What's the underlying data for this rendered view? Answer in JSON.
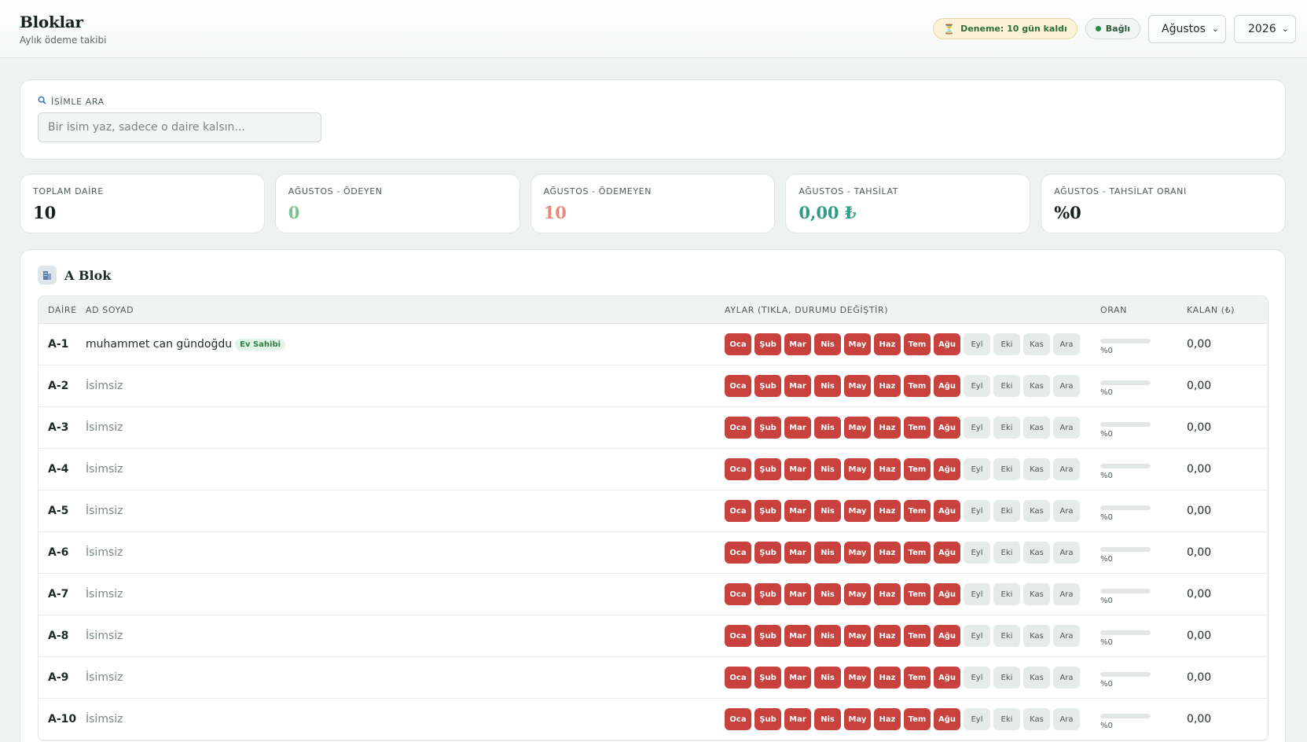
{
  "header": {
    "title": "Bloklar",
    "subtitle": "Aylık ödeme takibi",
    "trial_badge": "Deneme: 10 gün kaldı",
    "connection_badge": "Bağlı",
    "month_select": "Ağustos",
    "year_select": "2026"
  },
  "search": {
    "label": "İSİMLE ARA",
    "placeholder": "Bir isim yaz, sadece o daire kalsın...",
    "value": ""
  },
  "stats": [
    {
      "label": "TOPLAM DAİRE",
      "value": "10",
      "color": "#17211f"
    },
    {
      "label": "AĞUSTOS - ÖDEYEN",
      "value": "0",
      "color": "#7cc48f"
    },
    {
      "label": "AĞUSTOS - ÖDEMEYEN",
      "value": "10",
      "color": "#e8897c"
    },
    {
      "label": "AĞUSTOS - TAHSİLAT",
      "value": "0,00 ₺",
      "color": "#2e9c86"
    },
    {
      "label": "AĞUSTOS - TAHSİLAT ORANI",
      "value": "%0",
      "color": "#17211f"
    }
  ],
  "block": {
    "title": "A Blok",
    "columns": {
      "daire": "DAİRE",
      "ad": "AD SOYAD",
      "aylar": "AYLAR (TIKLA, DURUMU DEĞİŞTİR)",
      "oran": "ORAN",
      "kalan": "KALAN (₺)"
    },
    "months": [
      "Oca",
      "Şub",
      "Mar",
      "Nis",
      "May",
      "Haz",
      "Tem",
      "Ağu",
      "Eyl",
      "Eki",
      "Kas",
      "Ara"
    ],
    "unpaid_count": 8,
    "owner_tag": "Ev Sahibi",
    "rows": [
      {
        "daire": "A-1",
        "name": "muhammet can gündoğdu",
        "owner": true,
        "oran": "%0",
        "ratio": 0,
        "kalan": "0,00"
      },
      {
        "daire": "A-2",
        "name": "İsimsiz",
        "owner": false,
        "oran": "%0",
        "ratio": 0,
        "kalan": "0,00"
      },
      {
        "daire": "A-3",
        "name": "İsimsiz",
        "owner": false,
        "oran": "%0",
        "ratio": 0,
        "kalan": "0,00"
      },
      {
        "daire": "A-4",
        "name": "İsimsiz",
        "owner": false,
        "oran": "%0",
        "ratio": 0,
        "kalan": "0,00"
      },
      {
        "daire": "A-5",
        "name": "İsimsiz",
        "owner": false,
        "oran": "%0",
        "ratio": 0,
        "kalan": "0,00"
      },
      {
        "daire": "A-6",
        "name": "İsimsiz",
        "owner": false,
        "oran": "%0",
        "ratio": 0,
        "kalan": "0,00"
      },
      {
        "daire": "A-7",
        "name": "İsimsiz",
        "owner": false,
        "oran": "%0",
        "ratio": 0,
        "kalan": "0,00"
      },
      {
        "daire": "A-8",
        "name": "İsimsiz",
        "owner": false,
        "oran": "%0",
        "ratio": 0,
        "kalan": "0,00"
      },
      {
        "daire": "A-9",
        "name": "İsimsiz",
        "owner": false,
        "oran": "%0",
        "ratio": 0,
        "kalan": "0,00"
      },
      {
        "daire": "A-10",
        "name": "İsimsiz",
        "owner": false,
        "oran": "%0",
        "ratio": 0,
        "kalan": "0,00"
      }
    ]
  },
  "icons": {
    "trial": "hourglass-icon",
    "connection": "status-dot-icon",
    "search": "magnifier-icon",
    "block": "building-icon"
  }
}
